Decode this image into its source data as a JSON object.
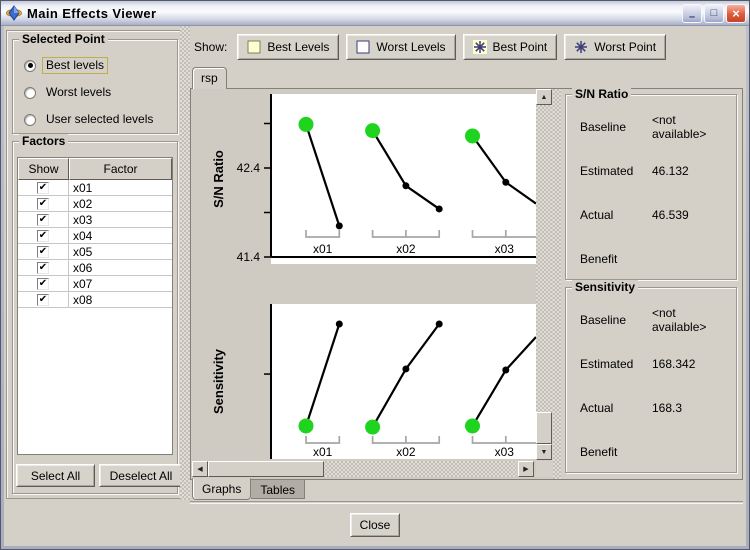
{
  "window": {
    "title": "Main Effects Viewer",
    "minimize_glyph": "–",
    "maximize_glyph": "□",
    "close_glyph": "×"
  },
  "selected_point": {
    "title": "Selected Point",
    "options": [
      {
        "label": "Best levels",
        "selected": true
      },
      {
        "label": "Worst levels",
        "selected": false
      },
      {
        "label": "User selected levels",
        "selected": false
      }
    ]
  },
  "factors": {
    "title": "Factors",
    "columns": [
      "Show",
      "Factor"
    ],
    "check_glyph": "✔",
    "rows": [
      {
        "checked": true,
        "factor": "x01"
      },
      {
        "checked": true,
        "factor": "x02"
      },
      {
        "checked": true,
        "factor": "x03"
      },
      {
        "checked": true,
        "factor": "x04"
      },
      {
        "checked": true,
        "factor": "x05"
      },
      {
        "checked": true,
        "factor": "x06"
      },
      {
        "checked": true,
        "factor": "x07"
      },
      {
        "checked": true,
        "factor": "x08"
      }
    ],
    "buttons": {
      "select_all": "Select All",
      "deselect_all": "Deselect All"
    }
  },
  "toolbar": {
    "show_label": "Show:",
    "buttons": [
      {
        "label": "Best Levels",
        "icon": "best-levels-icon"
      },
      {
        "label": "Worst Levels",
        "icon": "worst-levels-icon"
      },
      {
        "label": "Best Point",
        "icon": "best-point-icon"
      },
      {
        "label": "Worst Point",
        "icon": "worst-point-icon"
      }
    ]
  },
  "tabs": {
    "top": [
      {
        "label": "rsp",
        "active": true
      }
    ],
    "bottom": [
      {
        "label": "Graphs",
        "active": true
      },
      {
        "label": "Tables",
        "active": false
      }
    ]
  },
  "stats": [
    {
      "title": "S/N Ratio",
      "rows": [
        {
          "label": "Baseline",
          "value": "<not available>"
        },
        {
          "label": "Estimated",
          "value": "46.132"
        },
        {
          "label": "Actual",
          "value": "46.539"
        },
        {
          "label": "Benefit",
          "value": ""
        }
      ]
    },
    {
      "title": "Sensitivity",
      "rows": [
        {
          "label": "Baseline",
          "value": "<not available>"
        },
        {
          "label": "Estimated",
          "value": "168.342"
        },
        {
          "label": "Actual",
          "value": "168.3"
        },
        {
          "label": "Benefit",
          "value": ""
        }
      ]
    }
  ],
  "close_button": "Close",
  "scrollbar_glyphs": {
    "up": "▲",
    "down": "▼",
    "left": "◀",
    "right": "▶"
  },
  "colors": {
    "best_point_green": "#1fd41f",
    "line_black": "#000000",
    "bracket_gray": "#a6a6a6",
    "icon_navy": "#3c3c78",
    "icon_yellow": "#ffffd6",
    "dialog_bg": "#d4d0c8"
  },
  "chart_data": [
    {
      "type": "line",
      "ylabel": "S/N Ratio",
      "ylim": [
        41.4,
        43.25
      ],
      "yticks": [
        {
          "v": 41.4,
          "label": "41.4"
        },
        {
          "v": 41.9,
          "label": ""
        },
        {
          "v": 42.4,
          "label": "42.4"
        },
        {
          "v": 42.9,
          "label": ""
        }
      ],
      "categories": [
        "x01",
        "x02",
        "x03"
      ],
      "series": [
        {
          "factor": "x01",
          "levels": [
            {
              "v": 42.89,
              "best": true
            },
            {
              "v": 41.75
            }
          ]
        },
        {
          "factor": "x02",
          "levels": [
            {
              "v": 42.82,
              "best": true
            },
            {
              "v": 42.2
            },
            {
              "v": 41.94
            }
          ]
        },
        {
          "factor": "x03",
          "levels": [
            {
              "v": 42.76,
              "best": true
            },
            {
              "v": 42.24
            },
            {
              "v": 42.0,
              "clipped": true
            }
          ]
        }
      ],
      "grid": false,
      "note": "green marker = selected best level; x03 last segment clipped at right viewport edge"
    },
    {
      "type": "line",
      "ylabel": "Sensitivity",
      "ylim": [
        0,
        1
      ],
      "yticks": [
        {
          "v": 0.548,
          "label": ""
        }
      ],
      "categories": [
        "x01",
        "x02",
        "x03"
      ],
      "series": [
        {
          "factor": "x01",
          "levels": [
            {
              "v": 0.213,
              "best": true
            },
            {
              "v": 0.871
            }
          ]
        },
        {
          "factor": "x02",
          "levels": [
            {
              "v": 0.206,
              "best": true
            },
            {
              "v": 0.581
            },
            {
              "v": 0.871
            }
          ]
        },
        {
          "factor": "x03",
          "levels": [
            {
              "v": 0.213,
              "best": true
            },
            {
              "v": 0.574
            },
            {
              "v": 0.787,
              "clipped": true
            }
          ]
        }
      ],
      "grid": false,
      "note": "no numeric y labels visible; values are fractions of the visible plot height; x03 clipped at right edge"
    }
  ]
}
